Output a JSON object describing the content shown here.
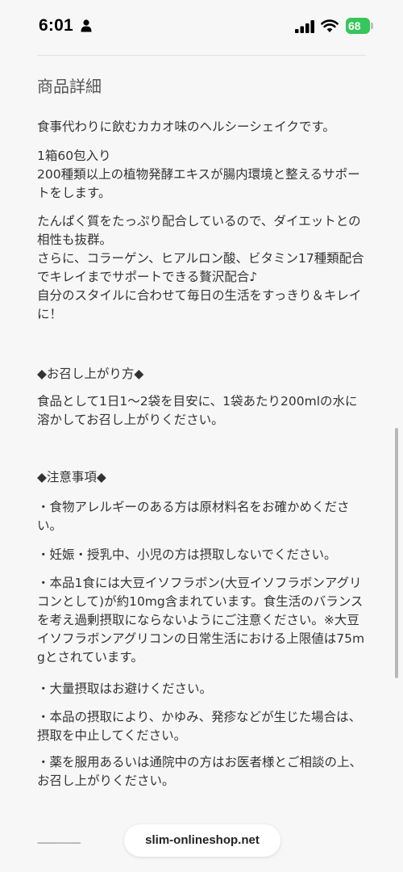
{
  "status_bar": {
    "time": "6:01",
    "battery": "68",
    "icons": [
      "person-icon",
      "signal-icon",
      "wifi-icon",
      "battery-icon"
    ]
  },
  "section": {
    "title": "商品詳細",
    "paragraphs": [
      "食事代わりに飲むカカオ味のヘルシーシェイクです。",
      "1箱60包入り\n200種類以上の植物発酵エキスが腸内環境と整えるサポートをします。",
      "たんぱく質をたっぷり配合しているので、ダイエットとの相性も抜群。\nさらに、コラーゲン、ヒアルロン酸、ビタミン17種類配合でキレイまでサポートできる贅沢配合♪\n自分のスタイルに合わせて毎日の生活をすっきり＆キレイに！"
    ],
    "howto_heading": "◆お召し上がり方◆",
    "howto_text": "食品として1日1〜2袋を目安に、1袋あたり200mlの水に溶かしてお召し上がりください。",
    "caution_heading": "◆注意事項◆",
    "cautions": [
      "・食物アレルギーのある方は原材料名をお確かめください。",
      "・妊娠・授乳中、小児の方は摂取しないでください。",
      "・本品1食には大豆イソフラボン(大豆イソフラボンアグリコンとして)が約10mg含まれています。食生活のバランスを考え過剰摂取にならないようにご注意ください。※大豆イソフラボンアグリコンの日常生活における上限値は75mgとされています。",
      "・大量摂取はお避けください。",
      "・本品の摂取により、かゆみ、発疹などが生じた場合は、摂取を中止してください。",
      "・薬を服用あるいは通院中の方はお医者様とご相談の上、お召し上がりください。"
    ],
    "separator": "------------------"
  },
  "browser": {
    "url": "slim-onlineshop.net"
  },
  "colors": {
    "battery_green": "#34c759",
    "background": "#f7f7f7"
  }
}
